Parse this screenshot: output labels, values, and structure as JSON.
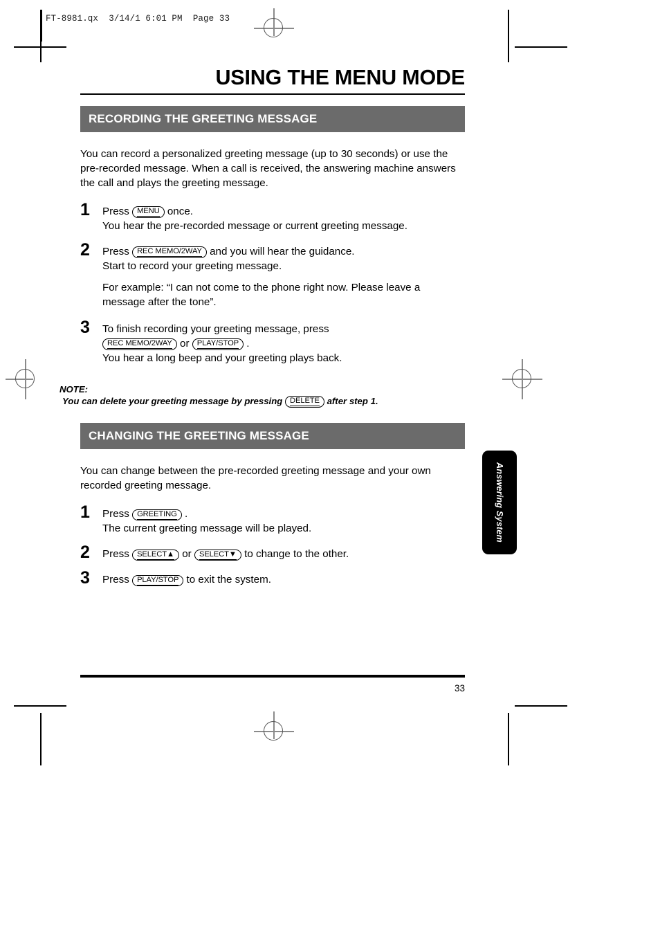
{
  "printer_slug": "FT-8981.qx  3/14/1 6:01 PM  Page 33",
  "document": {
    "title": "USING THE MENU MODE",
    "page_number": "33",
    "side_tab_label": "Answering System",
    "section_bar_color": "#6b6b6b"
  },
  "sections": [
    {
      "heading": "RECORDING THE GREETING MESSAGE",
      "intro": "You can record a personalized greeting message (up to 30 seconds) or use the pre-recorded message. When a call is received, the answering machine answers the call and plays the greeting message.",
      "steps": [
        {
          "number": "1",
          "lead": "Press",
          "key": "MENU",
          "after_key": "once.",
          "sub": "You hear the pre-recorded message or current greeting message."
        },
        {
          "number": "2",
          "lead": "Press",
          "key": "REC MEMO/2WAY",
          "after_key": "and you will hear the guidance.",
          "sub": "Start to record your greeting message."
        },
        {
          "number": "3",
          "lead": "To finish recording your greeting message, press",
          "key": "REC MEMO/2WAY",
          "conjunction": "or",
          "key2": "PLAY/STOP",
          "after_key": ".",
          "sub": "You hear a long beep and your greeting plays back."
        }
      ],
      "example": {
        "label": "For example:",
        "text": "“I can not come to the phone right now. Please leave a message after the tone”."
      },
      "note": {
        "label": "NOTE:",
        "text_before": "You can delete your greeting message by pressing",
        "key": "DELETE",
        "text_after": "after step 1."
      }
    },
    {
      "heading": "CHANGING THE GREETING MESSAGE",
      "intro": "You can change between the pre-recorded greeting message and your own recorded greeting message.",
      "steps": [
        {
          "number": "1",
          "lead": "Press",
          "key": "GREETING",
          "after_key": ".",
          "sub": "The current greeting message will be played."
        },
        {
          "number": "2",
          "lead": "Press",
          "key": "SELECT▲",
          "conjunction": "or",
          "key2": "SELECT▼",
          "after_key": "to change to the other."
        },
        {
          "number": "3",
          "lead": "Press",
          "key": "PLAY/STOP",
          "after_key": "to exit the system."
        }
      ]
    }
  ]
}
